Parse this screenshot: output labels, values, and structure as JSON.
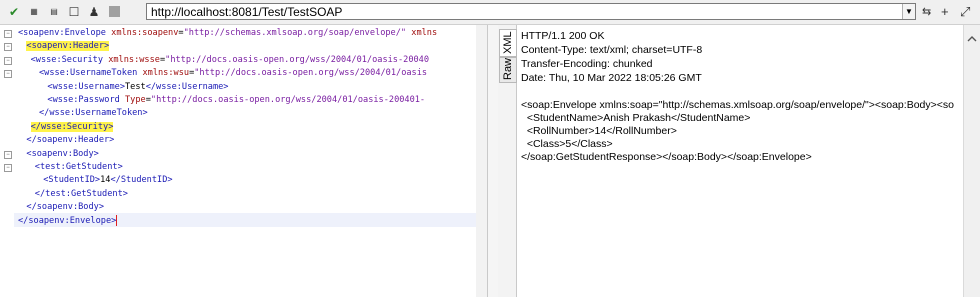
{
  "toolbar": {
    "icons": [
      "run-icon",
      "format-xml-icon",
      "format-rt-icon",
      "window-icon",
      "user-icon",
      "stop-icon"
    ],
    "url": "http://localhost:8081/Test/TestSOAP",
    "right_icons": [
      "settings-icon",
      "add-icon",
      "maximize-icon"
    ]
  },
  "request_editor": {
    "lines": [
      {
        "indent": 0,
        "parts": [
          [
            "tag",
            "<soapenv:Envelope "
          ],
          [
            "attr",
            "xmlns:soapenv"
          ],
          [
            "txt",
            "="
          ],
          [
            "val",
            "\"http://schemas.xmlsoap.org/soap/envelope/\""
          ],
          [
            "txt",
            " "
          ],
          [
            "attr",
            "xmlns"
          ]
        ]
      },
      {
        "indent": 2,
        "hl": true,
        "parts": [
          [
            "tag",
            "<soapenv:Header>"
          ]
        ]
      },
      {
        "indent": 3,
        "parts": [
          [
            "tag",
            "<wsse:Security "
          ],
          [
            "attr",
            "xmlns:wsse"
          ],
          [
            "txt",
            "="
          ],
          [
            "val",
            "\"http://docs.oasis-open.org/wss/2004/01/oasis-20040"
          ]
        ]
      },
      {
        "indent": 5,
        "parts": [
          [
            "tag",
            "<wsse:UsernameToken "
          ],
          [
            "attr",
            "xmlns:wsu"
          ],
          [
            "txt",
            "="
          ],
          [
            "val",
            "\"http://docs.oasis-open.org/wss/2004/01/oasis"
          ]
        ]
      },
      {
        "indent": 7,
        "parts": [
          [
            "tag",
            "<wsse:Username>"
          ],
          [
            "txt",
            "Test"
          ],
          [
            "tag",
            "</wsse:Username>"
          ]
        ]
      },
      {
        "indent": 7,
        "parts": [
          [
            "tag",
            "<wsse:Password "
          ],
          [
            "attr",
            "Type"
          ],
          [
            "txt",
            "="
          ],
          [
            "val",
            "\"http://docs.oasis-open.org/wss/2004/01/oasis-200401-"
          ]
        ]
      },
      {
        "indent": 5,
        "parts": [
          [
            "tag",
            "</wsse:UsernameToken>"
          ]
        ]
      },
      {
        "indent": 3,
        "hl": true,
        "parts": [
          [
            "tag",
            "</wsse:Security>"
          ]
        ]
      },
      {
        "indent": 2,
        "parts": [
          [
            "tag",
            "</soapenv:Header>"
          ]
        ]
      },
      {
        "indent": 2,
        "parts": [
          [
            "tag",
            "<soapenv:Body>"
          ]
        ]
      },
      {
        "indent": 4,
        "parts": [
          [
            "tag",
            "<test:GetStudent>"
          ]
        ]
      },
      {
        "indent": 6,
        "parts": [
          [
            "tag",
            "<StudentID>"
          ],
          [
            "txt",
            "14"
          ],
          [
            "tag",
            "</StudentID>"
          ]
        ]
      },
      {
        "indent": 4,
        "parts": [
          [
            "tag",
            "</test:GetStudent>"
          ]
        ]
      },
      {
        "indent": 2,
        "parts": [
          [
            "tag",
            "</soapenv:Body>"
          ]
        ]
      },
      {
        "indent": 0,
        "parts": [
          [
            "tag",
            "</soapenv:Envelope>"
          ]
        ]
      }
    ]
  },
  "view_tabs": [
    "XML",
    "Raw"
  ],
  "response": {
    "lines": [
      "HTTP/1.1 200 OK",
      "Content-Type: text/xml; charset=UTF-8",
      "Transfer-Encoding: chunked",
      "Date: Thu, 10 Mar 2022 18:05:26 GMT",
      "",
      "<soap:Envelope xmlns:soap=\"http://schemas.xmlsoap.org/soap/envelope/\"><soap:Body><so",
      "  <StudentName>Anish Prakash</StudentName>",
      "  <RollNumber>14</RollNumber>",
      "  <Class>5</Class>",
      "</soap:GetStudentResponse></soap:Body></soap:Envelope>"
    ]
  },
  "colors": {
    "tag": "#1b1bb5",
    "attribute": "#a01010",
    "value": "#7a1fa2",
    "highlight": "#fff34a"
  }
}
